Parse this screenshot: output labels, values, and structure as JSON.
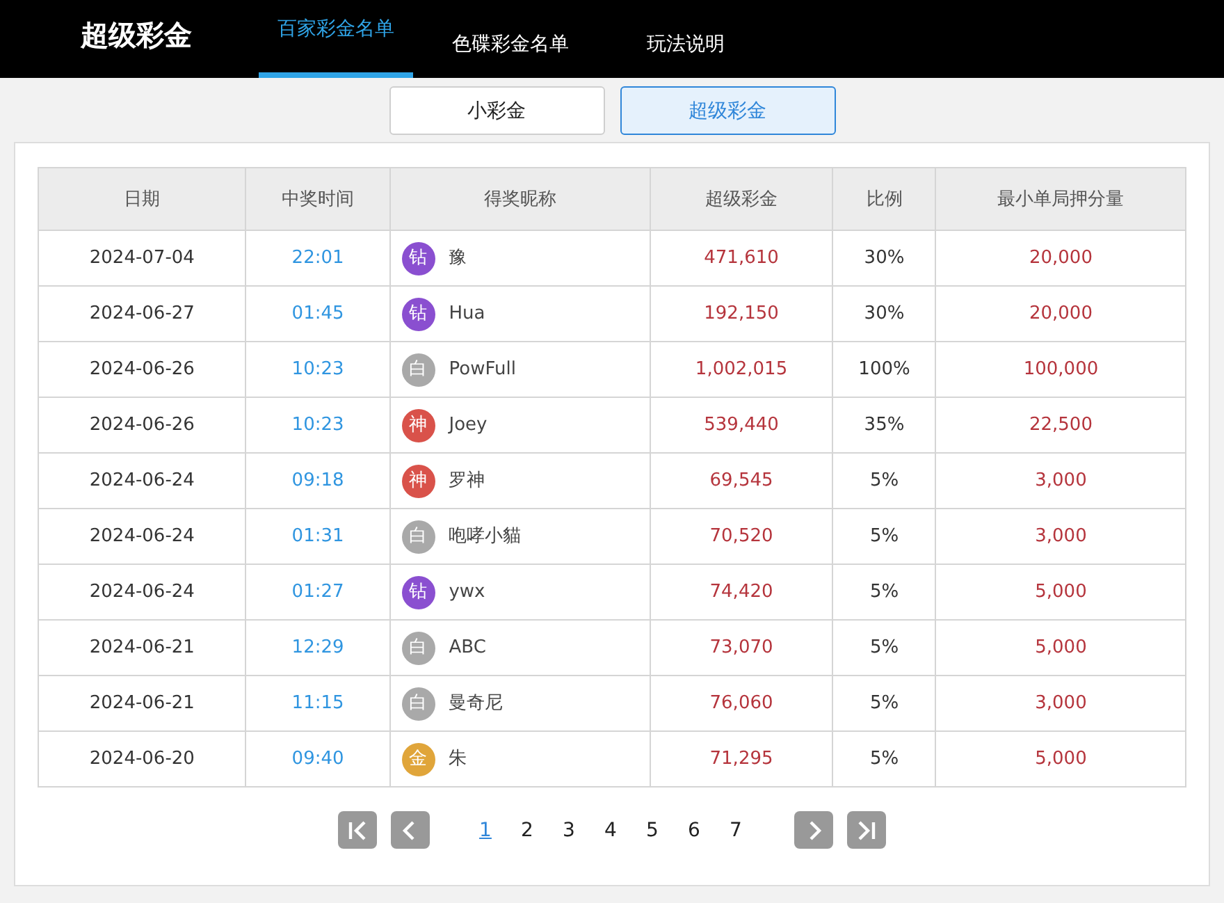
{
  "header": {
    "title": "超级彩金",
    "tabs": [
      {
        "label": "百家彩金名单",
        "selected": true
      },
      {
        "label": "色碟彩金名单",
        "selected": false
      },
      {
        "label": "玩法说明",
        "selected": false
      }
    ]
  },
  "subtabs": [
    {
      "label": "小彩金",
      "selected": false
    },
    {
      "label": "超级彩金",
      "selected": true
    }
  ],
  "table": {
    "columns": [
      "日期",
      "中奖时间",
      "得奖昵称",
      "超级彩金",
      "比例",
      "最小单局押分量"
    ],
    "rows": [
      {
        "date": "2024-07-04",
        "time": "22:01",
        "badge": "钻",
        "color": "#8a4fd0",
        "name": "豫",
        "jackpot": "471,610",
        "ratio": "30%",
        "min_bet": "20,000"
      },
      {
        "date": "2024-06-27",
        "time": "01:45",
        "badge": "钻",
        "color": "#8a4fd0",
        "name": "Hua",
        "jackpot": "192,150",
        "ratio": "30%",
        "min_bet": "20,000"
      },
      {
        "date": "2024-06-26",
        "time": "10:23",
        "badge": "白",
        "color": "#a9a9a9",
        "name": "PowFull",
        "jackpot": "1,002,015",
        "ratio": "100%",
        "min_bet": "100,000"
      },
      {
        "date": "2024-06-26",
        "time": "10:23",
        "badge": "神",
        "color": "#d9524a",
        "name": "Joey",
        "jackpot": "539,440",
        "ratio": "35%",
        "min_bet": "22,500"
      },
      {
        "date": "2024-06-24",
        "time": "09:18",
        "badge": "神",
        "color": "#d9524a",
        "name": "罗神",
        "jackpot": "69,545",
        "ratio": "5%",
        "min_bet": "3,000"
      },
      {
        "date": "2024-06-24",
        "time": "01:31",
        "badge": "白",
        "color": "#a9a9a9",
        "name": "咆哮小貓",
        "jackpot": "70,520",
        "ratio": "5%",
        "min_bet": "3,000"
      },
      {
        "date": "2024-06-24",
        "time": "01:27",
        "badge": "钻",
        "color": "#8a4fd0",
        "name": "ywx",
        "jackpot": "74,420",
        "ratio": "5%",
        "min_bet": "5,000"
      },
      {
        "date": "2024-06-21",
        "time": "12:29",
        "badge": "白",
        "color": "#a9a9a9",
        "name": "ABC",
        "jackpot": "73,070",
        "ratio": "5%",
        "min_bet": "5,000"
      },
      {
        "date": "2024-06-21",
        "time": "11:15",
        "badge": "白",
        "color": "#a9a9a9",
        "name": "曼奇尼",
        "jackpot": "76,060",
        "ratio": "5%",
        "min_bet": "3,000"
      },
      {
        "date": "2024-06-20",
        "time": "09:40",
        "badge": "金",
        "color": "#e0a53a",
        "name": "朱",
        "jackpot": "71,295",
        "ratio": "5%",
        "min_bet": "5,000"
      }
    ]
  },
  "pagination": {
    "pages": [
      {
        "label": "1",
        "selected": true
      },
      {
        "label": "2",
        "selected": false
      },
      {
        "label": "3",
        "selected": false
      },
      {
        "label": "4",
        "selected": false
      },
      {
        "label": "5",
        "selected": false
      },
      {
        "label": "6",
        "selected": false
      },
      {
        "label": "7",
        "selected": false
      }
    ]
  }
}
